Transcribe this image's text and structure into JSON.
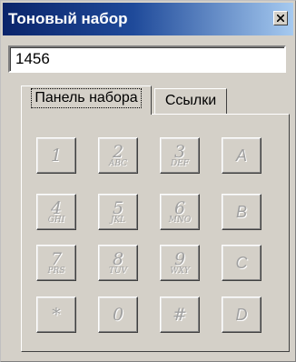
{
  "window": {
    "title": "Тоновый набор"
  },
  "number_field": {
    "value": "1456"
  },
  "tabs": [
    {
      "label": "Панель набора",
      "active": true
    },
    {
      "label": "Ссылки",
      "active": false
    }
  ],
  "keypad": {
    "keys": [
      {
        "main": "1",
        "sub": ""
      },
      {
        "main": "2",
        "sub": "ABC"
      },
      {
        "main": "3",
        "sub": "DEF"
      },
      {
        "main": "A",
        "sub": ""
      },
      {
        "main": "4",
        "sub": "GHI"
      },
      {
        "main": "5",
        "sub": "JKL"
      },
      {
        "main": "6",
        "sub": "MNO"
      },
      {
        "main": "B",
        "sub": ""
      },
      {
        "main": "7",
        "sub": "PRS"
      },
      {
        "main": "8",
        "sub": "TUV"
      },
      {
        "main": "9",
        "sub": "WXY"
      },
      {
        "main": "C",
        "sub": ""
      },
      {
        "main": "*",
        "sub": ""
      },
      {
        "main": "0",
        "sub": ""
      },
      {
        "main": "#",
        "sub": ""
      },
      {
        "main": "D",
        "sub": ""
      }
    ]
  }
}
